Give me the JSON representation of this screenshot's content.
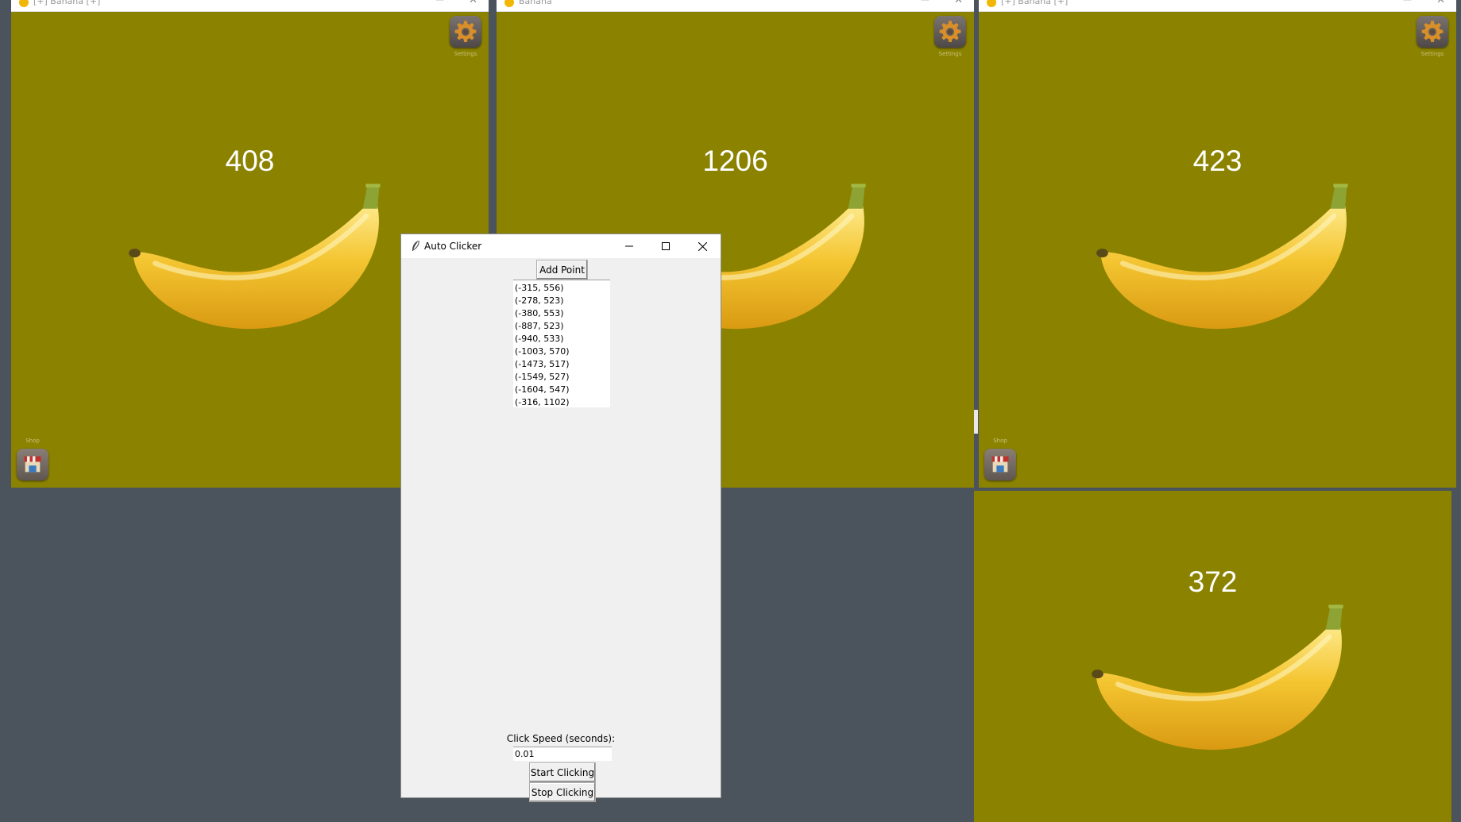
{
  "game_windows": [
    {
      "title": "[+] Banana [+]",
      "count": "408",
      "settings_label": "Settings",
      "shop_label": "Shop"
    },
    {
      "title": "Banana",
      "count": "1206",
      "settings_label": "Settings"
    },
    {
      "title": "[+] Banana [+]",
      "count": "423",
      "settings_label": "Settings",
      "shop_label": "Shop"
    },
    {
      "count": "372"
    }
  ],
  "auto_clicker": {
    "title": "Auto Clicker",
    "add_point_label": "Add Point",
    "points": [
      "(-315, 556)",
      "(-278, 523)",
      "(-380, 553)",
      "(-887, 523)",
      "(-940, 533)",
      "(-1003, 570)",
      "(-1473, 517)",
      "(-1549, 527)",
      "(-1604, 547)",
      "(-316, 1102)"
    ],
    "speed_label": "Click Speed (seconds):",
    "speed_value": "0.01",
    "start_label": "Start Clicking",
    "stop_label": "Stop Clicking"
  },
  "colors": {
    "game_bg": "#8b8200",
    "desktop_bg": "#4b545c",
    "dialog_bg": "#f0f0f0"
  }
}
